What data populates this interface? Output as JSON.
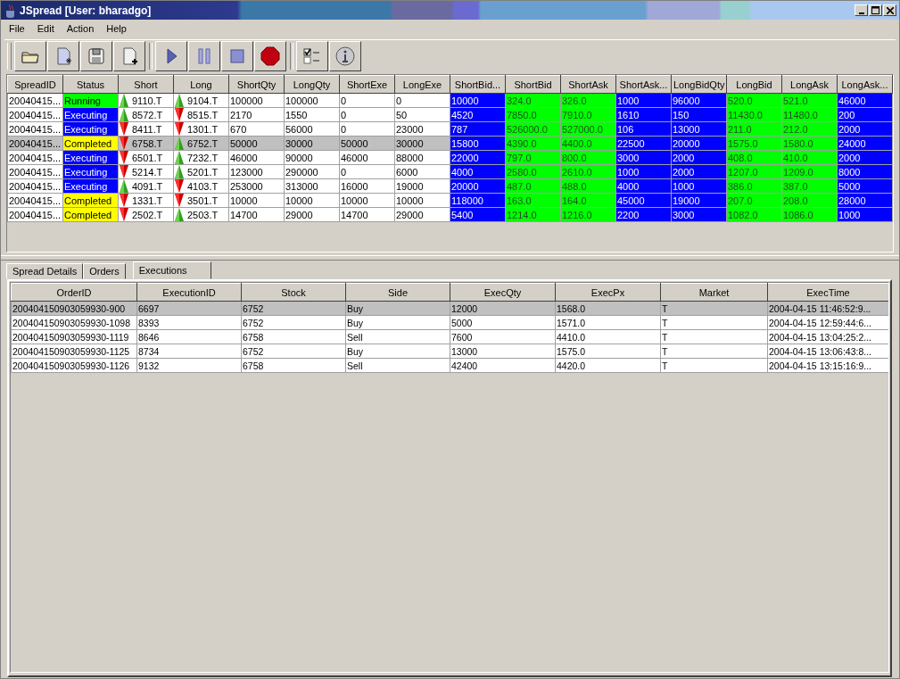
{
  "window": {
    "title": "JSpread [User: bharadgo]"
  },
  "menu": [
    "File",
    "Edit",
    "Action",
    "Help"
  ],
  "top_table": {
    "columns": [
      {
        "label": "SpreadID",
        "kind": "text"
      },
      {
        "label": "Status",
        "kind": "status"
      },
      {
        "label": "Short",
        "kind": "trend"
      },
      {
        "label": "Long",
        "kind": "trend"
      },
      {
        "label": "ShortQty",
        "kind": "text"
      },
      {
        "label": "LongQty",
        "kind": "text"
      },
      {
        "label": "ShortExe",
        "kind": "text"
      },
      {
        "label": "LongExe",
        "kind": "text"
      },
      {
        "label": "ShortBid...",
        "kind": "colored",
        "color": "#0000ff"
      },
      {
        "label": "ShortBid",
        "kind": "colored",
        "color": "#00ff00"
      },
      {
        "label": "ShortAsk",
        "kind": "colored",
        "color": "#00ff00"
      },
      {
        "label": "ShortAsk...",
        "kind": "colored",
        "color": "#0000ff"
      },
      {
        "label": "LongBidQty",
        "kind": "colored",
        "color": "#0000ff"
      },
      {
        "label": "LongBid",
        "kind": "colored",
        "color": "#00ff00"
      },
      {
        "label": "LongAsk",
        "kind": "colored",
        "color": "#00ff00"
      },
      {
        "label": "LongAsk...",
        "kind": "colored",
        "color": "#0000ff"
      }
    ],
    "rows": [
      {
        "selected": false,
        "color": "#00ff00",
        "short_rising": true,
        "long_rising": true,
        "cells": [
          "20040415...",
          "Running",
          "9110.T",
          "9104.T",
          "100000",
          "100000",
          "0",
          "0",
          "10000",
          "324.0",
          "326.0",
          "1000",
          "96000",
          "520.0",
          "521.0",
          "46000"
        ]
      },
      {
        "selected": false,
        "color": "#0000ff",
        "short_rising": true,
        "long_rising": false,
        "cells": [
          "20040415...",
          "Executing",
          "8572.T",
          "8515.T",
          "2170",
          "1550",
          "0",
          "50",
          "4520",
          "7850.0",
          "7910.0",
          "1610",
          "150",
          "11430.0",
          "11480.0",
          "200"
        ]
      },
      {
        "selected": false,
        "color": "#0000ff",
        "short_rising": false,
        "long_rising": false,
        "cells": [
          "20040415...",
          "Executing",
          "8411.T",
          "1301.T",
          "670",
          "56000",
          "0",
          "23000",
          "787",
          "526000.0",
          "527000.0",
          "106",
          "13000",
          "211.0",
          "212.0",
          "2000"
        ]
      },
      {
        "selected": true,
        "color": "#ffff00",
        "short_rising": false,
        "long_rising": true,
        "cells": [
          "20040415...",
          "Completed",
          "6758.T",
          "6752.T",
          "50000",
          "30000",
          "50000",
          "30000",
          "15800",
          "4390.0",
          "4400.0",
          "22500",
          "20000",
          "1575.0",
          "1580.0",
          "24000"
        ]
      },
      {
        "selected": false,
        "color": "#0000ff",
        "short_rising": false,
        "long_rising": true,
        "cells": [
          "20040415...",
          "Executing",
          "6501.T",
          "7232.T",
          "46000",
          "90000",
          "46000",
          "88000",
          "22000",
          "797.0",
          "800.0",
          "3000",
          "2000",
          "408.0",
          "410.0",
          "2000"
        ]
      },
      {
        "selected": false,
        "color": "#0000ff",
        "short_rising": false,
        "long_rising": true,
        "cells": [
          "20040415...",
          "Executing",
          "5214.T",
          "5201.T",
          "123000",
          "290000",
          "0",
          "6000",
          "4000",
          "2580.0",
          "2610.0",
          "1000",
          "2000",
          "1207.0",
          "1209.0",
          "8000"
        ]
      },
      {
        "selected": false,
        "color": "#0000ff",
        "short_rising": true,
        "long_rising": false,
        "cells": [
          "20040415...",
          "Executing",
          "4091.T",
          "4103.T",
          "253000",
          "313000",
          "16000",
          "19000",
          "20000",
          "487.0",
          "488.0",
          "4000",
          "1000",
          "386.0",
          "387.0",
          "5000"
        ]
      },
      {
        "selected": false,
        "color": "#ffff00",
        "short_rising": false,
        "long_rising": false,
        "cells": [
          "20040415...",
          "Completed",
          "1331.T",
          "3501.T",
          "10000",
          "10000",
          "10000",
          "10000",
          "118000",
          "163.0",
          "164.0",
          "45000",
          "19000",
          "207.0",
          "208.0",
          "28000"
        ]
      },
      {
        "selected": false,
        "color": "#ffff00",
        "short_rising": false,
        "long_rising": true,
        "cells": [
          "20040415...",
          "Completed",
          "2502.T",
          "2503.T",
          "14700",
          "29000",
          "14700",
          "29000",
          "5400",
          "1214.0",
          "1216.0",
          "2200",
          "3000",
          "1082.0",
          "1086.0",
          "1000"
        ]
      }
    ]
  },
  "tabs": [
    {
      "label": "Spread Details",
      "selected": false
    },
    {
      "label": "Orders",
      "selected": false
    },
    {
      "label": "Executions",
      "selected": true
    }
  ],
  "executions": {
    "columns": [
      "OrderID",
      "ExecutionID",
      "Stock",
      "Side",
      "ExecQty",
      "ExecPx",
      "Market",
      "ExecTime"
    ],
    "rows": [
      {
        "selected": true,
        "cells": [
          "200404150903059930-900",
          "6697",
          "6752",
          "Buy",
          "12000",
          "1568.0",
          "T",
          "2004-04-15 11:46:52:9..."
        ]
      },
      {
        "selected": false,
        "cells": [
          "200404150903059930-1098",
          "8393",
          "6752",
          "Buy",
          "5000",
          "1571.0",
          "T",
          "2004-04-15 12:59:44:6..."
        ]
      },
      {
        "selected": false,
        "cells": [
          "200404150903059930-1119",
          "8646",
          "6758",
          "Sell",
          "7600",
          "4410.0",
          "T",
          "2004-04-15 13:04:25:2..."
        ]
      },
      {
        "selected": false,
        "cells": [
          "200404150903059930-1125",
          "8734",
          "6752",
          "Buy",
          "13000",
          "1575.0",
          "T",
          "2004-04-15 13:06:43:8..."
        ]
      },
      {
        "selected": false,
        "cells": [
          "200404150903059930-1126",
          "9132",
          "6758",
          "Sell",
          "42400",
          "4420.0",
          "T",
          "2004-04-15 13:15:16:9..."
        ]
      }
    ]
  }
}
